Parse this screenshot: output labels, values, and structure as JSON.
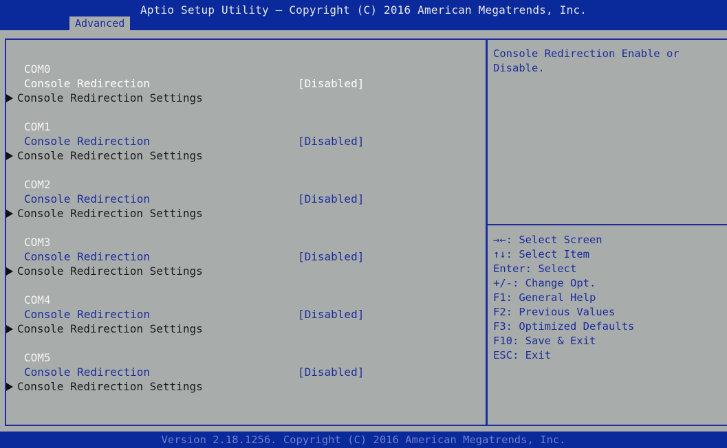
{
  "header": {
    "title": "Aptio Setup Utility – Copyright (C) 2016 American Megatrends, Inc.",
    "active_tab": "Advanced"
  },
  "ports": [
    {
      "name": "COM0",
      "option_label": "Console Redirection",
      "option_value": "[Disabled]",
      "submenu_label": "Console Redirection Settings"
    },
    {
      "name": "COM1",
      "option_label": "Console Redirection",
      "option_value": "[Disabled]",
      "submenu_label": "Console Redirection Settings"
    },
    {
      "name": "COM2",
      "option_label": "Console Redirection",
      "option_value": "[Disabled]",
      "submenu_label": "Console Redirection Settings"
    },
    {
      "name": "COM3",
      "option_label": "Console Redirection",
      "option_value": "[Disabled]",
      "submenu_label": "Console Redirection Settings"
    },
    {
      "name": "COM4",
      "option_label": "Console Redirection",
      "option_value": "[Disabled]",
      "submenu_label": "Console Redirection Settings"
    },
    {
      "name": "COM5",
      "option_label": "Console Redirection",
      "option_value": "[Disabled]",
      "submenu_label": "Console Redirection Settings"
    }
  ],
  "help": {
    "description": "Console Redirection Enable or Disable.",
    "keys": [
      "→←: Select Screen",
      "↑↓: Select Item",
      "Enter: Select",
      "+/-: Change Opt.",
      "F1: General Help",
      "F2: Previous Values",
      "F3: Optimized Defaults",
      "F10: Save & Exit",
      "ESC: Exit"
    ]
  },
  "footer": {
    "text": "Version 2.18.1256. Copyright (C) 2016 American Megatrends, Inc."
  },
  "colors": {
    "header_bg": "#0a2a9c",
    "body_bg": "#a8adab",
    "accent_text": "#1c2c9c",
    "selected_text": "#ffffff"
  }
}
